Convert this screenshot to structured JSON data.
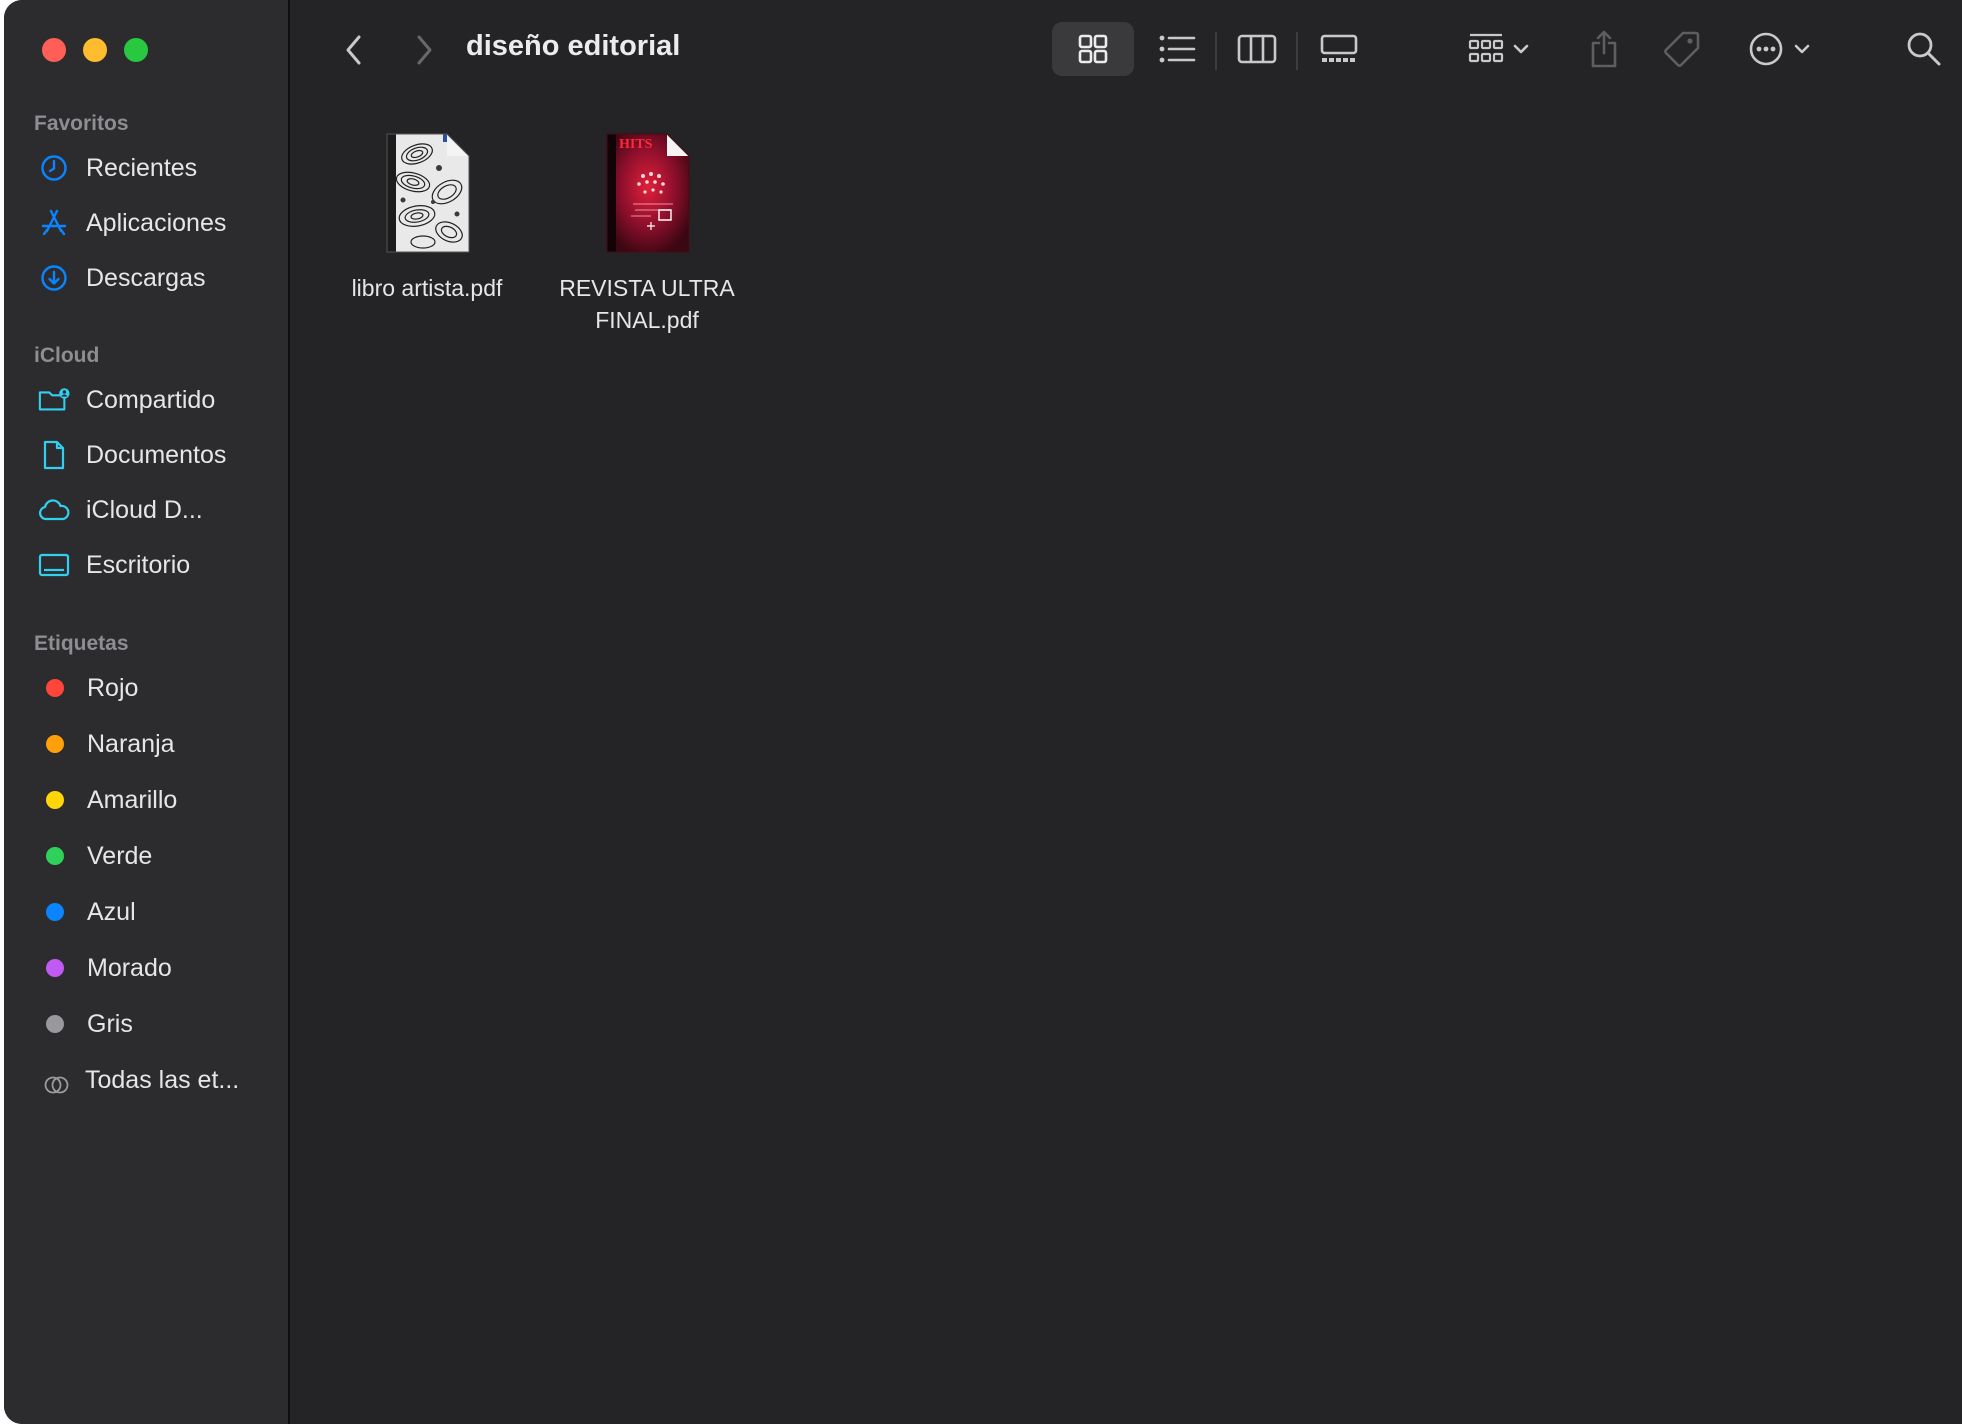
{
  "window": {
    "title": "diseño editorial"
  },
  "traffic_lights": {
    "close": "#ff5f57",
    "minimize": "#febc2e",
    "zoom": "#28c840"
  },
  "sidebar": {
    "sections": [
      {
        "title": "Favoritos",
        "items": [
          {
            "label": "Recientes",
            "icon": "clock-icon"
          },
          {
            "label": "Aplicaciones",
            "icon": "apps-icon"
          },
          {
            "label": "Descargas",
            "icon": "download-icon"
          }
        ]
      },
      {
        "title": "iCloud",
        "items": [
          {
            "label": "Compartido",
            "icon": "shared-folder-icon"
          },
          {
            "label": "Documentos",
            "icon": "document-icon"
          },
          {
            "label": "iCloud D...",
            "icon": "cloud-icon"
          },
          {
            "label": "Escritorio",
            "icon": "desktop-icon"
          }
        ]
      },
      {
        "title": "Etiquetas",
        "items": [
          {
            "label": "Rojo",
            "color": "#ff453a"
          },
          {
            "label": "Naranja",
            "color": "#ff9f0a"
          },
          {
            "label": "Amarillo",
            "color": "#ffd60a"
          },
          {
            "label": "Verde",
            "color": "#30d158"
          },
          {
            "label": "Azul",
            "color": "#0a84ff"
          },
          {
            "label": "Morado",
            "color": "#bf5af2"
          },
          {
            "label": "Gris",
            "color": "#98989d"
          },
          {
            "label": "Todas las et...",
            "icon": "all-tags-icon"
          }
        ]
      }
    ]
  },
  "toolbar": {
    "back": "chevron-left-icon",
    "forward": "chevron-right-icon",
    "views": [
      "icon-view",
      "list-view",
      "column-view",
      "gallery-view"
    ],
    "active_view": "icon-view",
    "group": "group-icon",
    "share": "share-icon",
    "tags": "tag-icon",
    "more": "more-icon",
    "search": "search-icon"
  },
  "files": [
    {
      "name": "libro artista.pdf",
      "thumbnail": "black-white-art-cover"
    },
    {
      "name": "REVISTA ULTRA FINAL.pdf",
      "thumbnail": "red-magazine-cover",
      "cover_text": "HITS"
    }
  ],
  "colors": {
    "accent_icon": "#0a84ff",
    "icloud_icon": "#32d0f0"
  }
}
